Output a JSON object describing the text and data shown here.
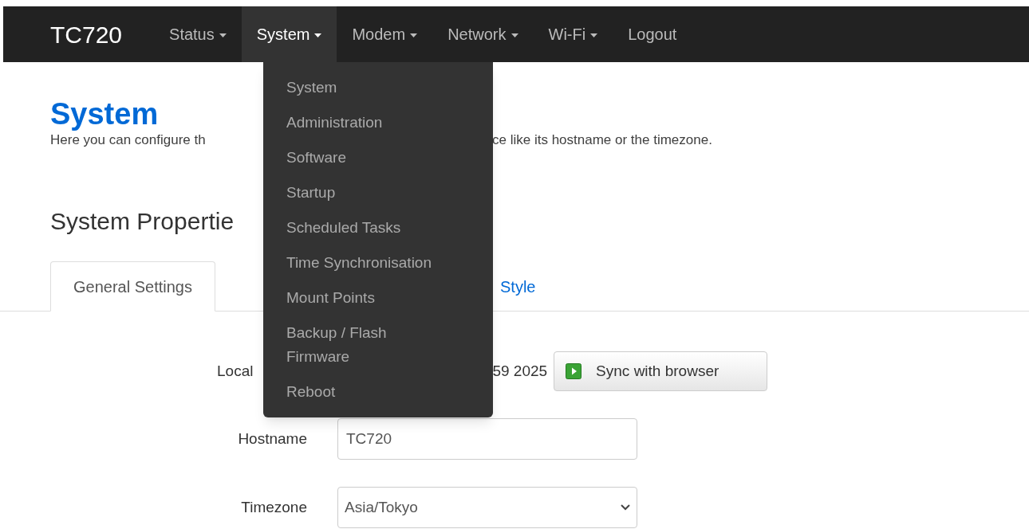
{
  "navbar": {
    "brand": "TC720",
    "items": [
      {
        "label": "Status",
        "caret": true,
        "selected": false
      },
      {
        "label": "System",
        "caret": true,
        "selected": true
      },
      {
        "label": "Modem",
        "caret": true,
        "selected": false
      },
      {
        "label": "Network",
        "caret": true,
        "selected": false
      },
      {
        "label": "Wi-Fi",
        "caret": true,
        "selected": false
      },
      {
        "label": "Logout",
        "caret": false,
        "selected": false
      }
    ]
  },
  "dropdown_menu": {
    "items": [
      "System",
      "Administration",
      "Software",
      "Startup",
      "Scheduled Tasks",
      "Time Synchronisation",
      "Mount Points",
      "Backup / Flash Firmware",
      "Reboot"
    ]
  },
  "page": {
    "title": "System",
    "description_parts": [
      "Here you can configure th",
      "ce like its hostname or the timezone."
    ],
    "section_title": "System Propertie"
  },
  "tabs": [
    {
      "label": "General Settings",
      "selected": true
    },
    {
      "label": "Style",
      "selected": false
    }
  ],
  "form": {
    "local_time": {
      "label": "Local",
      "value": "59 2025",
      "button": "Sync with browser"
    },
    "hostname": {
      "label": "Hostname",
      "value": "TC720"
    },
    "timezone": {
      "label": "Timezone",
      "value": "Asia/Tokyo"
    }
  }
}
